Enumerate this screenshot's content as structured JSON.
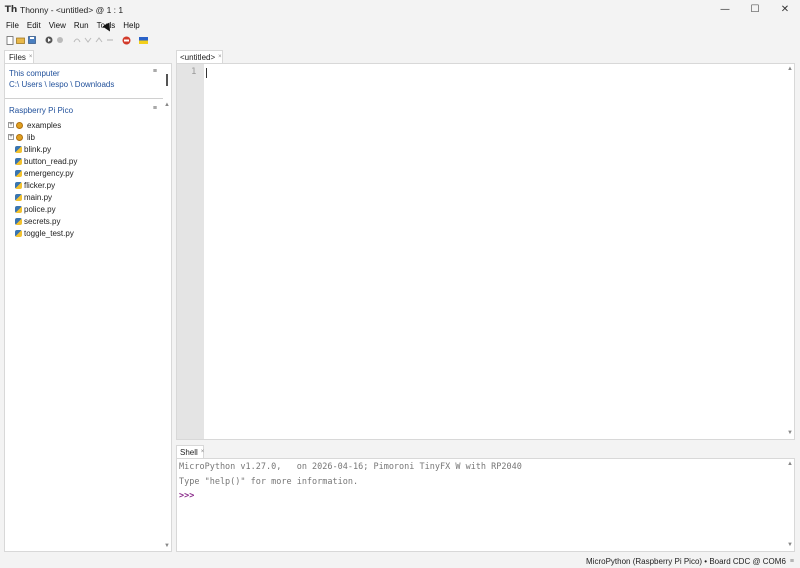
{
  "window": {
    "icon": "Th",
    "title": "Thonny  -  <untitled>  @  1 : 1",
    "controls": {
      "minimize": "—",
      "maximize": "☐",
      "close": "✕"
    }
  },
  "menu": [
    "File",
    "Edit",
    "View",
    "Run",
    "Tools",
    "Help"
  ],
  "toolbar": {
    "icons": [
      "new-file-icon",
      "open-file-icon",
      "save-icon",
      "run-icon",
      "debug-icon",
      "step-over-icon",
      "step-into-icon",
      "step-out-icon",
      "resume-icon",
      "stop-icon",
      "ukraine-flag-icon"
    ]
  },
  "files": {
    "tab_label": "Files",
    "tab_close": "×",
    "this_computer": {
      "title": "This computer",
      "path": "C:\\ Users \\ lespo \\ Downloads",
      "menu_icon": "≡"
    },
    "device": {
      "title": "Raspberry Pi Pico",
      "menu_icon": "≡",
      "items": [
        {
          "name": "examples",
          "type": "folder",
          "expander": "+"
        },
        {
          "name": "lib",
          "type": "folder",
          "expander": "+"
        },
        {
          "name": "blink.py",
          "type": "py"
        },
        {
          "name": "button_read.py",
          "type": "py"
        },
        {
          "name": "emergency.py",
          "type": "py"
        },
        {
          "name": "flicker.py",
          "type": "py"
        },
        {
          "name": "main.py",
          "type": "py"
        },
        {
          "name": "police.py",
          "type": "py"
        },
        {
          "name": "secrets.py",
          "type": "py"
        },
        {
          "name": "toggle_test.py",
          "type": "py"
        }
      ]
    }
  },
  "editor": {
    "tab_label": "<untitled>",
    "tab_close": "×",
    "line_numbers": [
      "1"
    ]
  },
  "shell": {
    "tab_label": "Shell",
    "tab_close": "×",
    "lines": [
      "MicroPython v1.27.0,   on 2026-04-16; Pimoroni TinyFX W with RP2040",
      "Type \"help()\" for more information."
    ],
    "prompt": ">>>"
  },
  "status": {
    "interpreter": "MicroPython (Raspberry Pi Pico)  •  Board CDC @ COM6",
    "grip": "≡"
  }
}
